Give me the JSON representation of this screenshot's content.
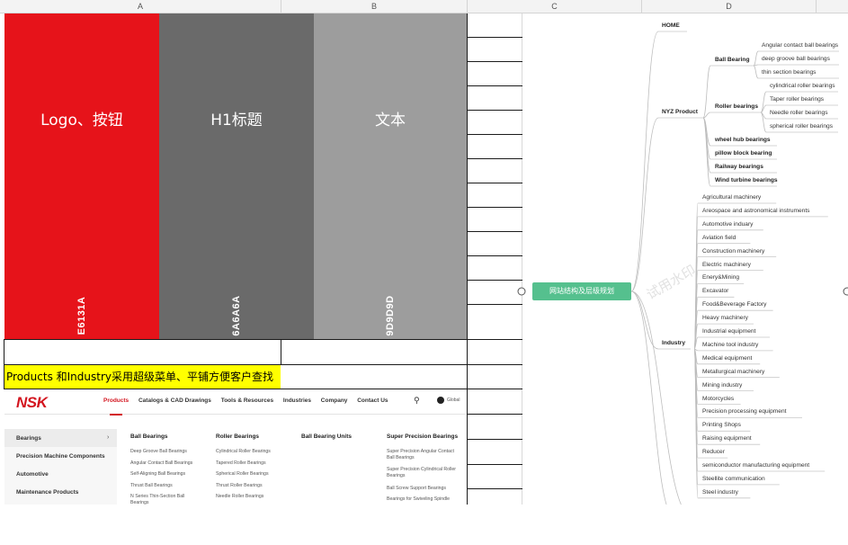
{
  "columns": [
    "A",
    "B",
    "C",
    "D"
  ],
  "swatches": [
    {
      "label": "Logo、按钮",
      "code": "E6131A",
      "color": "#E6131A"
    },
    {
      "label": "H1标题",
      "code": "6A6A6A",
      "color": "#6A6A6A"
    },
    {
      "label": "文本",
      "code": "9D9D9D",
      "color": "#9D9D9D"
    }
  ],
  "note": "Products 和Industry采用超级菜单、平铺方便客户查找",
  "nsk": {
    "logo": "NSK",
    "nav": [
      "Products",
      "Catalogs & CAD Drawings",
      "Tools & Resources",
      "Industries",
      "Company",
      "Contact Us"
    ],
    "search_icon": "⚲",
    "global_label": "Global",
    "sidebar": [
      "Bearings",
      "Precision Machine Components",
      "Automotive",
      "Maintenance Products"
    ],
    "sidebar_chevron": "›",
    "columns": [
      {
        "title": "Ball Bearings",
        "links": [
          "Deep Groove Ball Bearings",
          "Angular Contact Ball Bearings",
          "Self-Aligning Ball Bearings",
          "Thrust Ball Bearings",
          "N Series Thin-Section Ball Bearings"
        ]
      },
      {
        "title": "Roller Bearings",
        "links": [
          "Cylindrical Roller Bearings",
          "Tapered Roller Bearings",
          "Spherical Roller Bearings",
          "Thrust Roller Bearings",
          "Needle Roller Bearings"
        ]
      },
      {
        "title": "Ball Bearing Units",
        "links": []
      },
      {
        "title": "Super Precision Bearings",
        "links": [
          "Super Precision Angular Contact Ball Bearings",
          "Super Precision Cylindrical Roller Bearings",
          "Ball Screw Support Bearings",
          "Bearings for Swiveling Spindle"
        ]
      }
    ]
  },
  "mindmap": {
    "root": "网站结构及层级规划",
    "watermark": "试用水印",
    "home": "HOME",
    "product": "NYZ Product",
    "ball_bearing": "Ball Bearing",
    "ball_children": [
      "Angular contact ball bearings",
      "deep groove ball bearings",
      "thin section bearings"
    ],
    "roller_bearing": "Roller bearings",
    "roller_children": [
      "cylindrical roller bearings",
      "Taper roller bearings",
      "Needle roller bearings",
      "spherical roller bearings"
    ],
    "product_others": [
      "wheel hub bearings",
      "pillow block bearing",
      "Railway bearings",
      "Wind turbine bearings"
    ],
    "industry": "Industry",
    "industry_children": [
      "Agricultural machinery",
      "Areospace and astronomical instruments",
      "Automotive induary",
      "Aviation field",
      "Construction machinery",
      "Electric machinery",
      "Enery&Mining",
      "Excavator",
      "Food&Beverage Factory",
      "Heavy machinery",
      "Industrial equipment",
      "Machine tool industry",
      "Medical equipment",
      "Metallurgical machinery",
      "Mining industry",
      "Motorcycles",
      "Precision processing equipment",
      "Printing Shops",
      "Raising equipment",
      "Reducer",
      "semiconductor manufacturing equipment",
      "Steellite communication",
      "Steel industry"
    ]
  }
}
